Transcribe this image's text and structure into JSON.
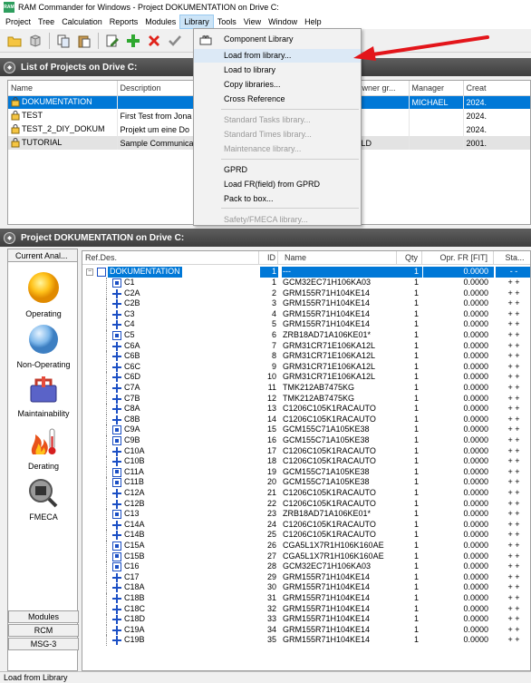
{
  "window": {
    "title": "RAM Commander for Windows - Project DOKUMENTATION on Drive C:",
    "app_icon_text": "RAM"
  },
  "menubar": [
    "Project",
    "Tree",
    "Calculation",
    "Reports",
    "Modules",
    "Library",
    "Tools",
    "View",
    "Window",
    "Help"
  ],
  "active_menu": "Library",
  "dropdown": {
    "items": [
      {
        "label": "Component Library",
        "enabled": true,
        "icon": "component-library-icon"
      },
      {
        "label": "Load from library...",
        "enabled": true,
        "highlighted": true
      },
      {
        "label": "Load to library",
        "enabled": true
      },
      {
        "label": "Copy libraries...",
        "enabled": true
      },
      {
        "label": "Cross Reference",
        "enabled": true
      },
      {
        "label": "Standard Tasks library...",
        "enabled": false
      },
      {
        "label": "Standard Times library...",
        "enabled": false
      },
      {
        "label": "Maintenance library...",
        "enabled": false
      },
      {
        "label": "GPRD",
        "enabled": true
      },
      {
        "label": "Load FR(field) from GPRD",
        "enabled": true
      },
      {
        "label": "Pack to box...",
        "enabled": true
      },
      {
        "label": "Safety/FMECA library...",
        "enabled": false
      }
    ]
  },
  "annotation": {
    "color": "#e3151a"
  },
  "projects_panel": {
    "title": "List of Projects on Drive C:",
    "columns": [
      "Name",
      "Description",
      "wner",
      "Owner gr...",
      "Manager",
      "Creat"
    ],
    "rows": [
      {
        "name": "DOKUMENTATION",
        "description": "",
        "owner": "HAEL",
        "owner_group": "",
        "manager": "MICHAEL",
        "created": "2024.",
        "selected": true
      },
      {
        "name": "TEST",
        "description": "First Test from Jona",
        "owner": "HAEL",
        "owner_group": "",
        "manager": "",
        "created": "2024."
      },
      {
        "name": "TEST_2_DIY_DOKUM",
        "description": "Projekt um eine Do",
        "owner": "HAEL",
        "owner_group": "",
        "manager": "",
        "created": "2024."
      },
      {
        "name": "TUTORIAL",
        "description": "Sample Communicat",
        "owner": "",
        "owner_group": "ALD",
        "manager": "",
        "created": "2001.",
        "gray": true
      }
    ]
  },
  "project_panel": {
    "title": "Project DOKUMENTATION on Drive C:",
    "sidebar": {
      "top_tab": "Current Anal...",
      "items": [
        "Operating",
        "Non-Operating",
        "Maintainability",
        "Derating",
        "FMECA"
      ],
      "bottom_tabs": [
        "Modules",
        "RCM",
        "MSG-3"
      ]
    },
    "columns": [
      "Ref.Des.",
      "ID",
      "Name",
      "Qty",
      "Opr. FR [FIT]",
      "Sta..."
    ],
    "root": {
      "ref": "DOKUMENTATION",
      "id": "1",
      "name": "---",
      "qty": "1",
      "fr": "0.0000",
      "status": "- -"
    },
    "rows": [
      {
        "ref": "C1",
        "id": "1",
        "name": "GCM32EC71H106KA03",
        "qty": "1",
        "fr": "0.0000",
        "status": "+ +",
        "icon": "box"
      },
      {
        "ref": "C2A",
        "id": "2",
        "name": "GRM155R71H104KE14",
        "qty": "1",
        "fr": "0.0000",
        "status": "+ +",
        "icon": "plain"
      },
      {
        "ref": "C2B",
        "id": "3",
        "name": "GRM155R71H104KE14",
        "qty": "1",
        "fr": "0.0000",
        "status": "+ +",
        "icon": "plain"
      },
      {
        "ref": "C3",
        "id": "4",
        "name": "GRM155R71H104KE14",
        "qty": "1",
        "fr": "0.0000",
        "status": "+ +",
        "icon": "plain"
      },
      {
        "ref": "C4",
        "id": "5",
        "name": "GRM155R71H104KE14",
        "qty": "1",
        "fr": "0.0000",
        "status": "+ +",
        "icon": "plain"
      },
      {
        "ref": "C5",
        "id": "6",
        "name": "ZRB18AD71A106KE01*",
        "qty": "1",
        "fr": "0.0000",
        "status": "+ +",
        "icon": "box"
      },
      {
        "ref": "C6A",
        "id": "7",
        "name": "GRM31CR71E106KA12L",
        "qty": "1",
        "fr": "0.0000",
        "status": "+ +",
        "icon": "plain"
      },
      {
        "ref": "C6B",
        "id": "8",
        "name": "GRM31CR71E106KA12L",
        "qty": "1",
        "fr": "0.0000",
        "status": "+ +",
        "icon": "plain"
      },
      {
        "ref": "C6C",
        "id": "9",
        "name": "GRM31CR71E106KA12L",
        "qty": "1",
        "fr": "0.0000",
        "status": "+ +",
        "icon": "plain"
      },
      {
        "ref": "C6D",
        "id": "10",
        "name": "GRM31CR71E106KA12L",
        "qty": "1",
        "fr": "0.0000",
        "status": "+ +",
        "icon": "plain"
      },
      {
        "ref": "C7A",
        "id": "11",
        "name": "TMK212AB7475KG",
        "qty": "1",
        "fr": "0.0000",
        "status": "+ +",
        "icon": "plain"
      },
      {
        "ref": "C7B",
        "id": "12",
        "name": "TMK212AB7475KG",
        "qty": "1",
        "fr": "0.0000",
        "status": "+ +",
        "icon": "plain"
      },
      {
        "ref": "C8A",
        "id": "13",
        "name": "C1206C105K1RACAUTO",
        "qty": "1",
        "fr": "0.0000",
        "status": "+ +",
        "icon": "plain"
      },
      {
        "ref": "C8B",
        "id": "14",
        "name": "C1206C105K1RACAUTO",
        "qty": "1",
        "fr": "0.0000",
        "status": "+ +",
        "icon": "plain"
      },
      {
        "ref": "C9A",
        "id": "15",
        "name": "GCM155C71A105KE38",
        "qty": "1",
        "fr": "0.0000",
        "status": "+ +",
        "icon": "box"
      },
      {
        "ref": "C9B",
        "id": "16",
        "name": "GCM155C71A105KE38",
        "qty": "1",
        "fr": "0.0000",
        "status": "+ +",
        "icon": "box"
      },
      {
        "ref": "C10A",
        "id": "17",
        "name": "C1206C105K1RACAUTO",
        "qty": "1",
        "fr": "0.0000",
        "status": "+ +",
        "icon": "plain"
      },
      {
        "ref": "C10B",
        "id": "18",
        "name": "C1206C105K1RACAUTO",
        "qty": "1",
        "fr": "0.0000",
        "status": "+ +",
        "icon": "plain"
      },
      {
        "ref": "C11A",
        "id": "19",
        "name": "GCM155C71A105KE38",
        "qty": "1",
        "fr": "0.0000",
        "status": "+ +",
        "icon": "box"
      },
      {
        "ref": "C11B",
        "id": "20",
        "name": "GCM155C71A105KE38",
        "qty": "1",
        "fr": "0.0000",
        "status": "+ +",
        "icon": "box"
      },
      {
        "ref": "C12A",
        "id": "21",
        "name": "C1206C105K1RACAUTO",
        "qty": "1",
        "fr": "0.0000",
        "status": "+ +",
        "icon": "plain"
      },
      {
        "ref": "C12B",
        "id": "22",
        "name": "C1206C105K1RACAUTO",
        "qty": "1",
        "fr": "0.0000",
        "status": "+ +",
        "icon": "plain"
      },
      {
        "ref": "C13",
        "id": "23",
        "name": "ZRB18AD71A106KE01*",
        "qty": "1",
        "fr": "0.0000",
        "status": "+ +",
        "icon": "box"
      },
      {
        "ref": "C14A",
        "id": "24",
        "name": "C1206C105K1RACAUTO",
        "qty": "1",
        "fr": "0.0000",
        "status": "+ +",
        "icon": "plain"
      },
      {
        "ref": "C14B",
        "id": "25",
        "name": "C1206C105K1RACAUTO",
        "qty": "1",
        "fr": "0.0000",
        "status": "+ +",
        "icon": "plain"
      },
      {
        "ref": "C15A",
        "id": "26",
        "name": "CGA5L1X7R1H106K160AE",
        "qty": "1",
        "fr": "0.0000",
        "status": "+ +",
        "icon": "box"
      },
      {
        "ref": "C15B",
        "id": "27",
        "name": "CGA5L1X7R1H106K160AE",
        "qty": "1",
        "fr": "0.0000",
        "status": "+ +",
        "icon": "box"
      },
      {
        "ref": "C16",
        "id": "28",
        "name": "GCM32EC71H106KA03",
        "qty": "1",
        "fr": "0.0000",
        "status": "+ +",
        "icon": "box"
      },
      {
        "ref": "C17",
        "id": "29",
        "name": "GRM155R71H104KE14",
        "qty": "1",
        "fr": "0.0000",
        "status": "+ +",
        "icon": "plain"
      },
      {
        "ref": "C18A",
        "id": "30",
        "name": "GRM155R71H104KE14",
        "qty": "1",
        "fr": "0.0000",
        "status": "+ +",
        "icon": "plain"
      },
      {
        "ref": "C18B",
        "id": "31",
        "name": "GRM155R71H104KE14",
        "qty": "1",
        "fr": "0.0000",
        "status": "+ +",
        "icon": "plain"
      },
      {
        "ref": "C18C",
        "id": "32",
        "name": "GRM155R71H104KE14",
        "qty": "1",
        "fr": "0.0000",
        "status": "+ +",
        "icon": "plain"
      },
      {
        "ref": "C18D",
        "id": "33",
        "name": "GRM155R71H104KE14",
        "qty": "1",
        "fr": "0.0000",
        "status": "+ +",
        "icon": "plain"
      },
      {
        "ref": "C19A",
        "id": "34",
        "name": "GRM155R71H104KE14",
        "qty": "1",
        "fr": "0.0000",
        "status": "+ +",
        "icon": "plain"
      },
      {
        "ref": "C19B",
        "id": "35",
        "name": "GRM155R71H104KE14",
        "qty": "1",
        "fr": "0.0000",
        "status": "+ +",
        "icon": "plain"
      }
    ]
  },
  "statusbar": {
    "text": "Load from Library"
  }
}
